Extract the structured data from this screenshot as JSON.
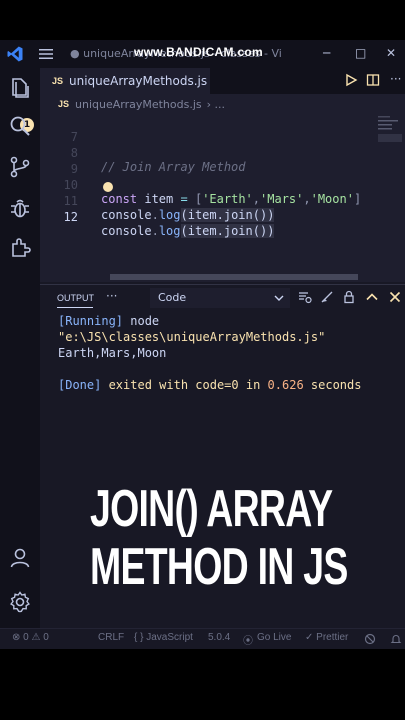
{
  "titlebar": {
    "title": "● uniqueArrayMethods.js - classes - Vi",
    "watermark": "www.BANDICAM.com",
    "minimize": "─",
    "maximize": "□",
    "close": "✕"
  },
  "activity": {
    "badge_count": "1"
  },
  "tab": {
    "lang_badge": "JS",
    "name": "uniqueArrayMethods.js"
  },
  "breadcrumb": {
    "lang_badge": "JS",
    "file": "uniqueArrayMethods.js",
    "sep": "› ..."
  },
  "editor": {
    "lines": [
      {
        "num": "7"
      },
      {
        "num": "8",
        "comment": "// Join Array Method"
      },
      {
        "num": "9"
      },
      {
        "num": "10",
        "kw": "const",
        "var": "item",
        "op": "=",
        "open": "[",
        "s1": "'Earth'",
        "c1": ",",
        "s2": "'Mars'",
        "c2": ",",
        "s3": "'Moon'",
        "close": "]"
      },
      {
        "num": "11",
        "obj": "console",
        "dot": ".",
        "fn": "log",
        "args": "(item.join())"
      },
      {
        "num": "12",
        "obj": "console",
        "dot": ".",
        "fn": "log",
        "args": "(item.join())"
      }
    ]
  },
  "panel": {
    "tab_label": "OUTPUT",
    "more": "···",
    "channel": "Code",
    "output": {
      "running_tag": "[Running]",
      "running_cmd": " node",
      "path": "\"e:\\JS\\classes\\uniqueArrayMethods.js\"",
      "result": "Earth,Mars,Moon",
      "done_tag": "[Done]",
      "done_text1": " exited with ",
      "done_code": "code=0",
      "done_text2": " in ",
      "done_time": "0.626",
      "done_text3": " seconds"
    }
  },
  "overlay": {
    "line1": "JOIN() ARRAY",
    "line2": "METHOD IN JS"
  },
  "status": {
    "errors": "⊗ 0 ⚠ 0",
    "eol": "CRLF",
    "lang": "{ } JavaScript",
    "version": "5.0.4",
    "golive": "Go Live",
    "prettier": "✓ Prettier"
  }
}
